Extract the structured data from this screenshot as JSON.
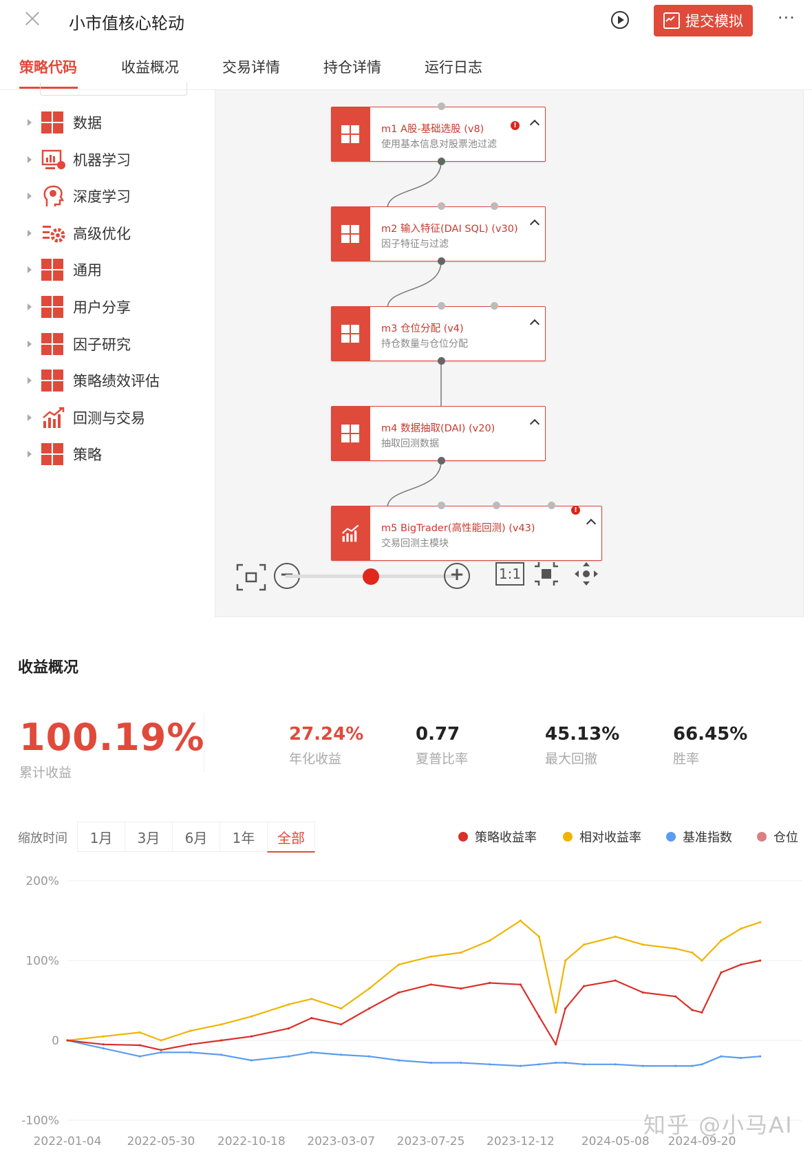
{
  "header": {
    "title": "小市值核心轮动",
    "submit_label": "提交模拟",
    "more": "···"
  },
  "tabs": [
    "策略代码",
    "收益概况",
    "交易详情",
    "持仓详情",
    "运行日志"
  ],
  "sidebar": [
    {
      "label": "数据",
      "icon": "grid-icon"
    },
    {
      "label": "机器学习",
      "icon": "monitor-chart-icon"
    },
    {
      "label": "深度学习",
      "icon": "brain-head-icon"
    },
    {
      "label": "高级优化",
      "icon": "gear-list-icon"
    },
    {
      "label": "通用",
      "icon": "grid-icon"
    },
    {
      "label": "用户分享",
      "icon": "grid-icon"
    },
    {
      "label": "因子研究",
      "icon": "grid-icon"
    },
    {
      "label": "策略绩效评估",
      "icon": "grid-icon"
    },
    {
      "label": "回测与交易",
      "icon": "bar-chart-icon"
    },
    {
      "label": "策略",
      "icon": "grid-icon"
    }
  ],
  "nodes": [
    {
      "title": "m1 A股-基础选股 (v8)",
      "subtitle": "使用基本信息对股票池过滤",
      "warning": true
    },
    {
      "title": "m2 输入特征(DAI SQL) (v30)",
      "subtitle": "因子特征与过滤",
      "warning": false
    },
    {
      "title": "m3 仓位分配 (v4)",
      "subtitle": "持仓数量与仓位分配",
      "warning": false
    },
    {
      "title": "m4 数据抽取(DAI) (v20)",
      "subtitle": "抽取回测数据",
      "warning": false
    },
    {
      "title": "m5 BigTrader(高性能回测) (v43)",
      "subtitle": "交易回测主模块",
      "warning": true
    }
  ],
  "zoom_toolbar": {
    "one_to_one": "1:1",
    "zoom_level": 0.35
  },
  "overview": {
    "title": "收益概况",
    "cumulative": {
      "value": "100.19%",
      "label": "累计收益"
    },
    "metrics": [
      {
        "value": "27.24%",
        "label": "年化收益",
        "color": "#e04a3b"
      },
      {
        "value": "0.77",
        "label": "夏普比率",
        "color": "#222222"
      },
      {
        "value": "45.13%",
        "label": "最大回撤",
        "color": "#222222"
      },
      {
        "value": "66.45%",
        "label": "胜率",
        "color": "#222222"
      }
    ]
  },
  "range": {
    "label": "缩放时间",
    "options": [
      "1月",
      "3月",
      "6月",
      "1年",
      "全部"
    ],
    "selected": "全部"
  },
  "legend": [
    {
      "name": "策略收益率",
      "color": "#d9302a"
    },
    {
      "name": "相对收益率",
      "color": "#f0b400"
    },
    {
      "name": "基准指数",
      "color": "#5b9cf0"
    },
    {
      "name": "仓位",
      "color": "#d98080"
    }
  ],
  "watermark": "知乎 @小马AI",
  "chart_data": {
    "type": "line",
    "x_ticks": [
      "2022-01-04",
      "2022-05-30",
      "2022-10-18",
      "2023-03-07",
      "2023-07-25",
      "2023-12-12",
      "2024-05-08",
      "2024-09-20"
    ],
    "y_ticks": [
      "200%",
      "100%",
      "0",
      "-100%"
    ],
    "ylim": [
      -100,
      200
    ],
    "x": [
      "2022-01-04",
      "2022-03-01",
      "2022-04-27",
      "2022-05-30",
      "2022-07-15",
      "2022-09-01",
      "2022-10-18",
      "2022-12-15",
      "2023-01-20",
      "2023-03-07",
      "2023-04-20",
      "2023-06-05",
      "2023-07-25",
      "2023-09-10",
      "2023-10-25",
      "2023-12-12",
      "2024-01-10",
      "2024-02-05",
      "2024-02-20",
      "2024-03-20",
      "2024-05-08",
      "2024-06-20",
      "2024-08-10",
      "2024-09-05",
      "2024-09-20",
      "2024-10-20",
      "2024-11-20",
      "2024-12-20"
    ],
    "series": [
      {
        "name": "策略收益率",
        "color": "#d9302a",
        "values": [
          0,
          -5,
          -6,
          -12,
          -5,
          0,
          5,
          15,
          28,
          20,
          40,
          60,
          70,
          65,
          72,
          70,
          30,
          -5,
          40,
          68,
          75,
          60,
          55,
          38,
          35,
          85,
          95,
          100
        ]
      },
      {
        "name": "相对收益率",
        "color": "#f0b400",
        "values": [
          0,
          5,
          10,
          0,
          12,
          20,
          30,
          45,
          52,
          40,
          65,
          95,
          105,
          110,
          125,
          150,
          130,
          35,
          100,
          120,
          130,
          120,
          115,
          110,
          100,
          125,
          140,
          148
        ]
      },
      {
        "name": "基准指数",
        "color": "#5b9cf0",
        "values": [
          0,
          -10,
          -20,
          -15,
          -15,
          -18,
          -25,
          -20,
          -15,
          -18,
          -20,
          -25,
          -28,
          -28,
          -30,
          -32,
          -30,
          -28,
          -28,
          -30,
          -30,
          -32,
          -32,
          -32,
          -30,
          -20,
          -22,
          -20
        ]
      }
    ]
  }
}
